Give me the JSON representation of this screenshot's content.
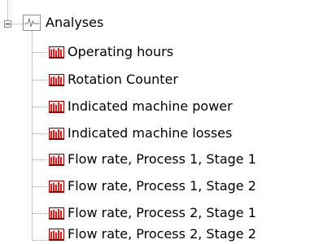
{
  "tree": {
    "root": {
      "label": "Analyses",
      "icon": "waveform-icon",
      "expanded": true
    },
    "items": [
      {
        "label": "Operating hours",
        "icon": "bar-chart-icon"
      },
      {
        "label": "Rotation Counter",
        "icon": "bar-chart-icon"
      },
      {
        "label": "Indicated machine power",
        "icon": "bar-chart-icon"
      },
      {
        "label": "Indicated machine losses",
        "icon": "bar-chart-icon"
      },
      {
        "label": "Flow rate, Process 1, Stage 1",
        "icon": "bar-chart-icon"
      },
      {
        "label": "Flow rate, Process 1, Stage 2",
        "icon": "bar-chart-icon"
      },
      {
        "label": "Flow rate, Process 2, Stage 1",
        "icon": "bar-chart-icon"
      },
      {
        "label": "Flow rate, Process 2, Stage 2",
        "icon": "bar-chart-icon"
      }
    ]
  },
  "colors": {
    "bar_icon_red": "#d42020",
    "bar_icon_border": "#8b0000",
    "connector_gray": "#a0a0a0"
  }
}
